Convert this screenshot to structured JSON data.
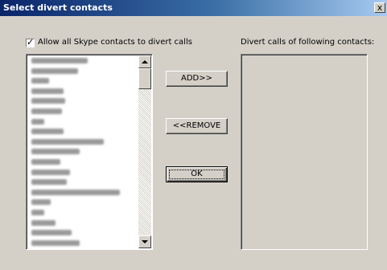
{
  "window": {
    "title": "Select divert contacts",
    "close_label": "x"
  },
  "allow_all": {
    "label": "Allow all Skype contacts to divert calls",
    "checked": true
  },
  "right_panel": {
    "label": "Divert calls of following contacts:"
  },
  "buttons": {
    "add": "ADD>>",
    "remove": "<<REMOVE",
    "ok": "OK"
  }
}
